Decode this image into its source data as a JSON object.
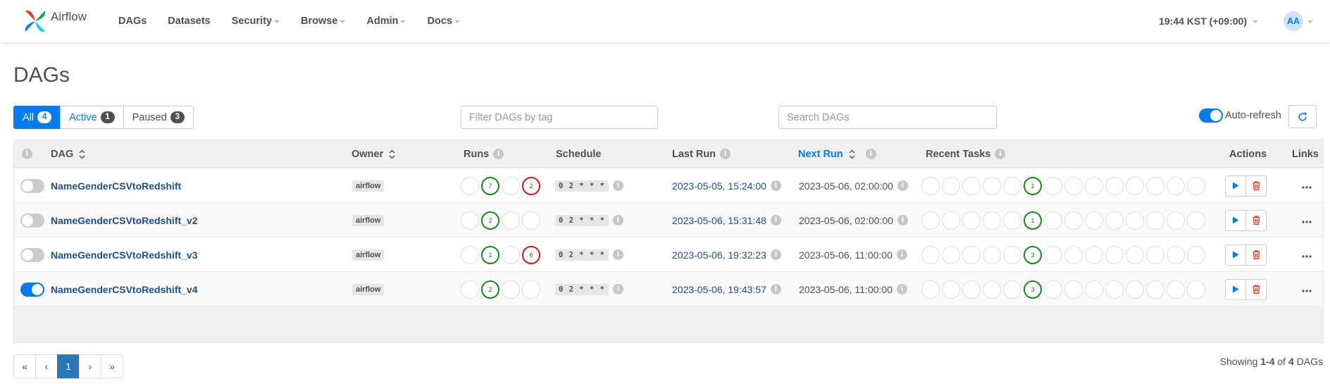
{
  "navbar": {
    "brand": "Airflow",
    "items": [
      {
        "label": "DAGs",
        "dropdown": false
      },
      {
        "label": "Datasets",
        "dropdown": false
      },
      {
        "label": "Security",
        "dropdown": true
      },
      {
        "label": "Browse",
        "dropdown": true
      },
      {
        "label": "Admin",
        "dropdown": true
      },
      {
        "label": "Docs",
        "dropdown": true
      }
    ],
    "time": "19:44 KST (+09:00)",
    "avatar": "AA"
  },
  "page": {
    "title": "DAGs"
  },
  "status_tabs": [
    {
      "label": "All",
      "count": "4"
    },
    {
      "label": "Active",
      "count": "1"
    },
    {
      "label": "Paused",
      "count": "3"
    }
  ],
  "filters": {
    "tag_placeholder": "Filter DAGs by tag",
    "search_placeholder": "Search DAGs",
    "auto_refresh_label": "Auto-refresh"
  },
  "table": {
    "headers": {
      "dag": "DAG",
      "owner": "Owner",
      "runs": "Runs",
      "schedule": "Schedule",
      "last_run": "Last Run",
      "next_run": "Next Run",
      "recent_tasks": "Recent Tasks",
      "actions": "Actions",
      "links": "Links"
    },
    "rows": [
      {
        "name": "NameGenderCSVtoRedshift",
        "active": false,
        "owner": "airflow",
        "runs": [
          {
            "s": "",
            "v": ""
          },
          {
            "s": "success",
            "v": "7"
          },
          {
            "s": "",
            "v": ""
          },
          {
            "s": "failed",
            "v": "2"
          }
        ],
        "schedule": "0 2 * * *",
        "last_run": "2023-05-05, 15:24:00",
        "next_run": "2023-05-06, 02:00:00",
        "task_index": 5,
        "task_value": "1"
      },
      {
        "name": "NameGenderCSVtoRedshift_v2",
        "active": false,
        "owner": "airflow",
        "runs": [
          {
            "s": "",
            "v": ""
          },
          {
            "s": "success",
            "v": "2"
          },
          {
            "s": "",
            "v": ""
          },
          {
            "s": "",
            "v": ""
          }
        ],
        "schedule": "0 2 * * *",
        "last_run": "2023-05-06, 15:31:48",
        "next_run": "2023-05-06, 02:00:00",
        "task_index": 5,
        "task_value": "1"
      },
      {
        "name": "NameGenderCSVtoRedshift_v3",
        "active": false,
        "owner": "airflow",
        "runs": [
          {
            "s": "",
            "v": ""
          },
          {
            "s": "success",
            "v": "1"
          },
          {
            "s": "",
            "v": ""
          },
          {
            "s": "failed",
            "v": "6"
          }
        ],
        "schedule": "0 2 * * *",
        "last_run": "2023-05-06, 19:32:23",
        "next_run": "2023-05-06, 11:00:00",
        "task_index": 5,
        "task_value": "3"
      },
      {
        "name": "NameGenderCSVtoRedshift_v4",
        "active": true,
        "owner": "airflow",
        "runs": [
          {
            "s": "",
            "v": ""
          },
          {
            "s": "success",
            "v": "2"
          },
          {
            "s": "",
            "v": ""
          },
          {
            "s": "",
            "v": ""
          }
        ],
        "schedule": "0 2 * * *",
        "last_run": "2023-05-06, 19:43:57",
        "next_run": "2023-05-06, 11:00:00",
        "task_index": 5,
        "task_value": "3"
      }
    ],
    "task_circle_count": 14
  },
  "pagination": {
    "first": "«",
    "prev": "‹",
    "current": "1",
    "next": "›",
    "last": "»"
  },
  "showing": {
    "prefix": "Showing",
    "range": "1-4",
    "of": "of",
    "total": "4",
    "suffix": "DAGs"
  }
}
